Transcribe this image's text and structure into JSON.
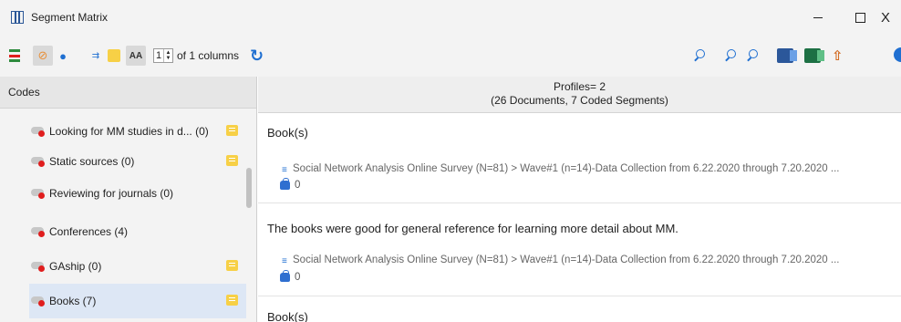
{
  "window": {
    "title": "Segment Matrix",
    "close_glyph": "X"
  },
  "toolbar": {
    "column_value": "1",
    "of_columns": "of 1 columns",
    "text_size_label": "AA"
  },
  "codes_panel": {
    "header": "Codes",
    "items": [
      {
        "label": "Looking for MM studies in d... (0)",
        "has_memo": true
      },
      {
        "label": "Static sources (0)",
        "has_memo": true
      },
      {
        "label": "Reviewing for journals (0)",
        "has_memo": false
      },
      {
        "label": "Conferences (4)",
        "has_memo": false
      },
      {
        "label": "GAship (0)",
        "has_memo": true
      },
      {
        "label": "Books (7)",
        "has_memo": true,
        "selected": true
      }
    ]
  },
  "matrix": {
    "profiles_line1": "Profiles= 2",
    "profiles_line2": "(26 Documents, 7 Coded Segments)",
    "segments": [
      {
        "title": "Book(s)",
        "source": "Social Network Analysis Online Survey (N=81) > Wave#1 (n=14)-Data Collection from 6.22.2020 through 7.20.2020 ...",
        "weight": "0"
      },
      {
        "title": "The books were good for general reference for learning more detail about MM.",
        "source": "Social Network Analysis Online Survey (N=81) > Wave#1 (n=14)-Data Collection from 6.22.2020 through 7.20.2020 ...",
        "weight": "0"
      },
      {
        "title": "Book(s)"
      }
    ]
  },
  "colors": {
    "accent": "#1f6fd1",
    "code_dot": "#e01e1e",
    "memo": "#f7d046",
    "selected_row": "#dde7f5"
  }
}
